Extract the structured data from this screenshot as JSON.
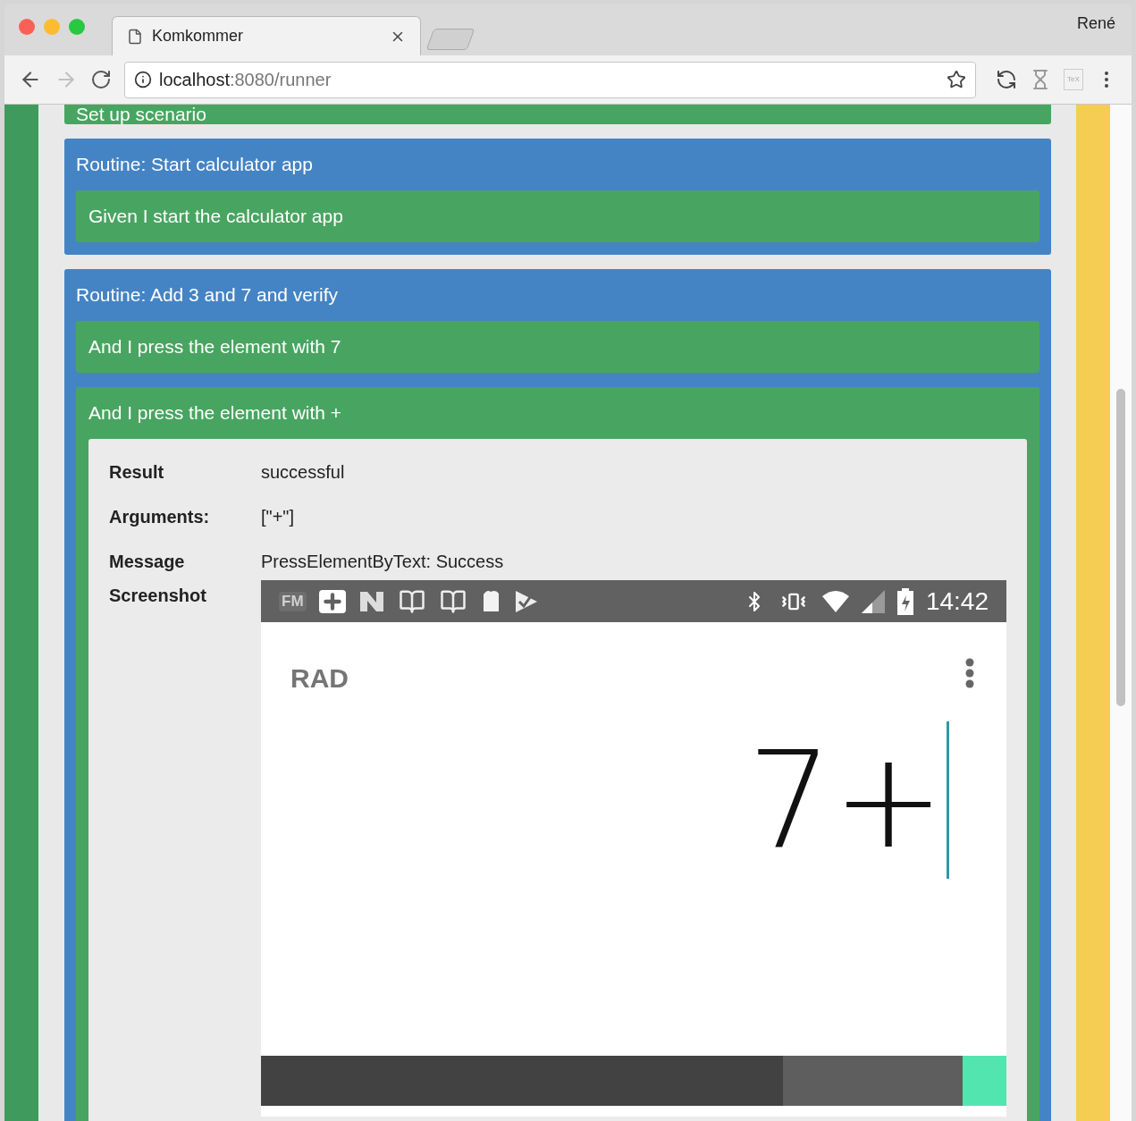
{
  "browser": {
    "tab_title": "Komkommer",
    "user": "René",
    "url_host": "localhost",
    "url_path": ":8080/runner",
    "extension_label": "TeX"
  },
  "scenario_header": "Set up scenario",
  "routines": [
    {
      "title": "Routine: Start calculator app",
      "steps": [
        {
          "text": "Given I start the calculator app"
        }
      ]
    },
    {
      "title": "Routine: Add 3 and 7 and verify",
      "steps": [
        {
          "text": "And I press the element with 7"
        },
        {
          "text": "And I press the element with +",
          "details": {
            "rows": [
              {
                "label": "Result",
                "value": "successful"
              },
              {
                "label": "Arguments:",
                "value": "[\"+\"]"
              },
              {
                "label": "Message",
                "value": "PressElementByText: Success"
              }
            ],
            "screenshot_label": "Screenshot",
            "phone": {
              "fm": "FM",
              "time": "14:42",
              "mode": "RAD",
              "display": "7+"
            }
          }
        }
      ]
    }
  ]
}
